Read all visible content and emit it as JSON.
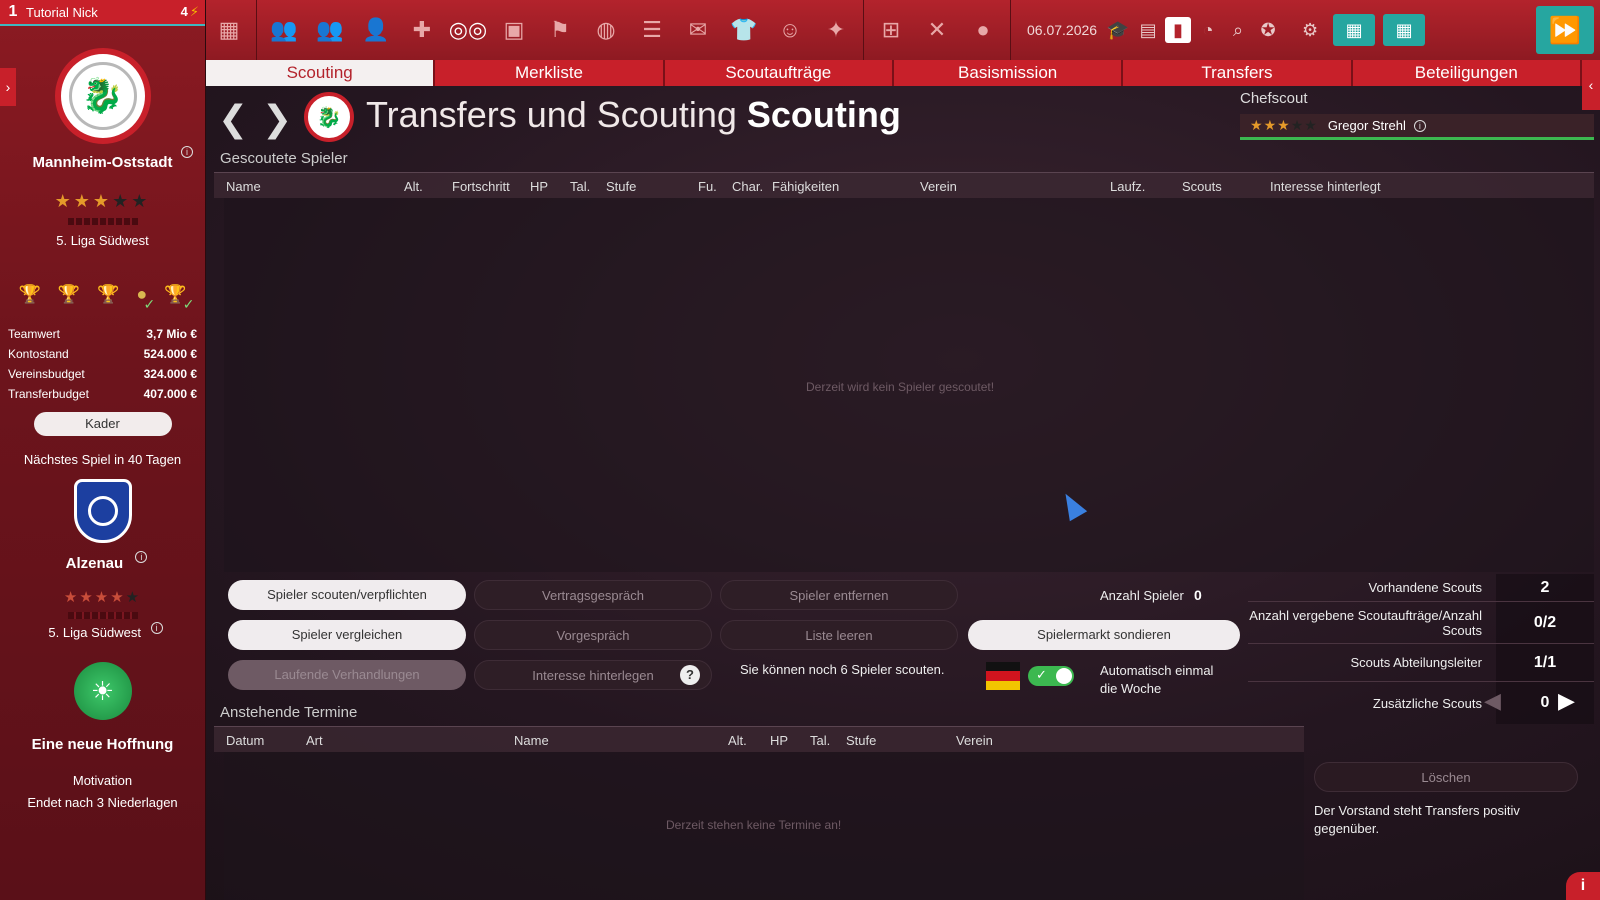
{
  "user": {
    "rank": "1",
    "name": "Tutorial Nick",
    "points": "4"
  },
  "club": {
    "name": "Mannheim-Oststadt",
    "stars_on": 3,
    "stars_total": 5,
    "league": "5. Liga Südwest"
  },
  "finances": [
    {
      "label": "Teamwert",
      "value": "3,7 Mio €"
    },
    {
      "label": "Kontostand",
      "value": "524.000 €"
    },
    {
      "label": "Vereinsbudget",
      "value": "324.000 €"
    },
    {
      "label": "Transferbudget",
      "value": "407.000 €"
    }
  ],
  "kader_label": "Kader",
  "next_game": "Nächstes Spiel in 40 Tagen",
  "opponent": {
    "name": "Alzenau",
    "league": "5. Liga Südwest",
    "stars_on": 4,
    "stars_total": 5
  },
  "motivation": {
    "title": "Eine neue Hoffnung",
    "label": "Motivation",
    "ends": "Endet nach 3 Niederlagen"
  },
  "topbar": {
    "date": "06.07.2026"
  },
  "tabs": [
    {
      "label": "Scouting",
      "active": true
    },
    {
      "label": "Merkliste"
    },
    {
      "label": "Scoutaufträge"
    },
    {
      "label": "Basismission"
    },
    {
      "label": "Transfers"
    },
    {
      "label": "Beteiligungen"
    }
  ],
  "header": {
    "title_light": "Transfers und Scouting",
    "title_bold": "Scouting"
  },
  "chefscout": {
    "label": "Chefscout",
    "name": "Gregor Strehl",
    "stars_on": 3,
    "stars_total": 5
  },
  "scouted": {
    "title": "Gescoutete Spieler",
    "columns": [
      "Name",
      "Alt.",
      "Fortschritt",
      "HP",
      "Tal.",
      "Stufe",
      "Fu.",
      "Char.",
      "Fähigkeiten",
      "Verein",
      "Laufz.",
      "Scouts",
      "Interesse hinterlegt"
    ],
    "empty": "Derzeit wird kein Spieler gescoutet!"
  },
  "actions": {
    "scout": "Spieler scouten/verpflichten",
    "vertrag": "Vertragsgespräch",
    "entfernen": "Spieler entfernen",
    "vergleichen": "Spieler vergleichen",
    "vorgespraech": "Vorgespräch",
    "leeren": "Liste leeren",
    "sondieren": "Spielermarkt sondieren",
    "verhandlungen": "Laufende Verhandlungen",
    "interesse": "Interesse hinterlegen",
    "help": "?",
    "anzahl_label": "Anzahl Spieler",
    "anzahl_value": "0",
    "remaining": "Sie können noch 6 Spieler scouten.",
    "auto_label": "Automatisch einmal die Woche"
  },
  "stats": [
    {
      "label": "Vorhandene Scouts",
      "value": "2"
    },
    {
      "label": "Anzahl vergebene Scoutaufträge/Anzahl Scouts",
      "value": "0/2"
    },
    {
      "label": "Scouts Abteilungsleiter",
      "value": "1/1"
    },
    {
      "label": "Zusätzliche Scouts",
      "value": "0"
    }
  ],
  "termine": {
    "title": "Anstehende Termine",
    "columns": [
      "Datum",
      "Art",
      "Name",
      "Alt.",
      "HP",
      "Tal.",
      "Stufe",
      "Verein"
    ],
    "empty": "Derzeit stehen keine Termine an!"
  },
  "loschen_label": "Löschen",
  "note": "Der Vorstand steht Transfers positiv gegenüber.",
  "colors": {
    "accent_red": "#c8202a",
    "teal": "#26a6a0",
    "green": "#3cb850"
  }
}
